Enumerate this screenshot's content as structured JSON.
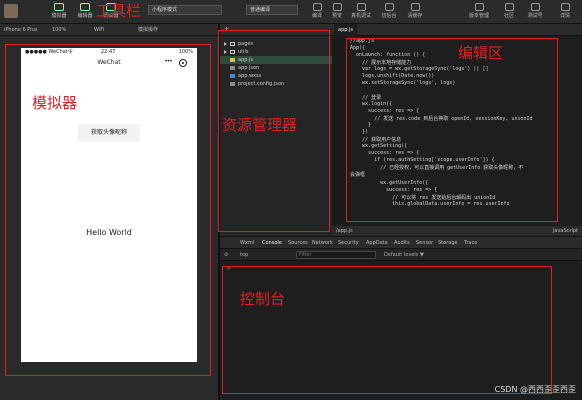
{
  "toolbar": {
    "buttons": [
      "模拟器",
      "编辑器",
      "调试器"
    ],
    "mode_select": "小程序模式",
    "compile_select": "普通编译",
    "actions": [
      "编译",
      "预览",
      "真机调试",
      "切后台",
      "清缓存"
    ],
    "right": [
      "版本管理",
      "社区",
      "测试号",
      "详情"
    ]
  },
  "simulator_bar": {
    "device": "iPhone 6 Plus",
    "zoom": "100%",
    "network": "WiFi",
    "ops": "模拟操作"
  },
  "phone": {
    "carrier": "●●●●● WeChat令",
    "time": "22:47",
    "battery": "100%",
    "title": "WeChat",
    "nav_dots": "•••",
    "avatar_button": "获取头像昵称",
    "hello": "Hello World"
  },
  "explorer": {
    "header_add": "+",
    "header_more": "...",
    "files": [
      {
        "name": "pages",
        "type": "folder"
      },
      {
        "name": "utils",
        "type": "folder"
      },
      {
        "name": "app.js",
        "type": "js"
      },
      {
        "name": "app.json",
        "type": "json"
      },
      {
        "name": "app.wxss",
        "type": "wxss"
      },
      {
        "name": "project.config.json",
        "type": "json"
      }
    ]
  },
  "editor": {
    "tab": "app.js",
    "lines": [
      "//app.js",
      "App({",
      "  onLaunch: function () {",
      "    // 展示本地存储能力",
      "    var logs = wx.getStorageSync('logs') || []",
      "    logs.unshift(Date.now())",
      "    wx.setStorageSync('logs', logs)",
      "",
      "    // 登录",
      "    wx.login({",
      "      success: res => {",
      "        // 发送 res.code 到后台换取 openId, sessionKey, unionId",
      "      }",
      "    })",
      "    // 获取用户信息",
      "    wx.getSetting({",
      "      success: res => {",
      "        if (res.authSetting['scope.userInfo']) {",
      "          // 已经授权，可以直接调用 getUserInfo 获取头像昵称，不",
      "会弹框",
      "          wx.getUserInfo({",
      "            success: res => {",
      "              // 可以将 res 发送给后台解码出 unionId",
      "              this.globalData.userInfo = res.userInfo"
    ],
    "status_file": "/app.js",
    "status_lang": "JavaScript"
  },
  "console": {
    "tabs": [
      "Wxml",
      "Console",
      "Sources",
      "Network",
      "Security",
      "AppData",
      "Audits",
      "Sensor",
      "Storage",
      "Trace"
    ],
    "context": "top",
    "filter_placeholder": "Filter",
    "levels": "Default levels ▼",
    "prompt": ">"
  },
  "annotations": {
    "toolbar": "工具栏",
    "simulator": "模拟器",
    "explorer": "资源管理器",
    "editor": "编辑区",
    "console": "控制台"
  },
  "watermark": "CSDN @西西歪歪西歪",
  "colors": {
    "annotation": "#e02020"
  }
}
